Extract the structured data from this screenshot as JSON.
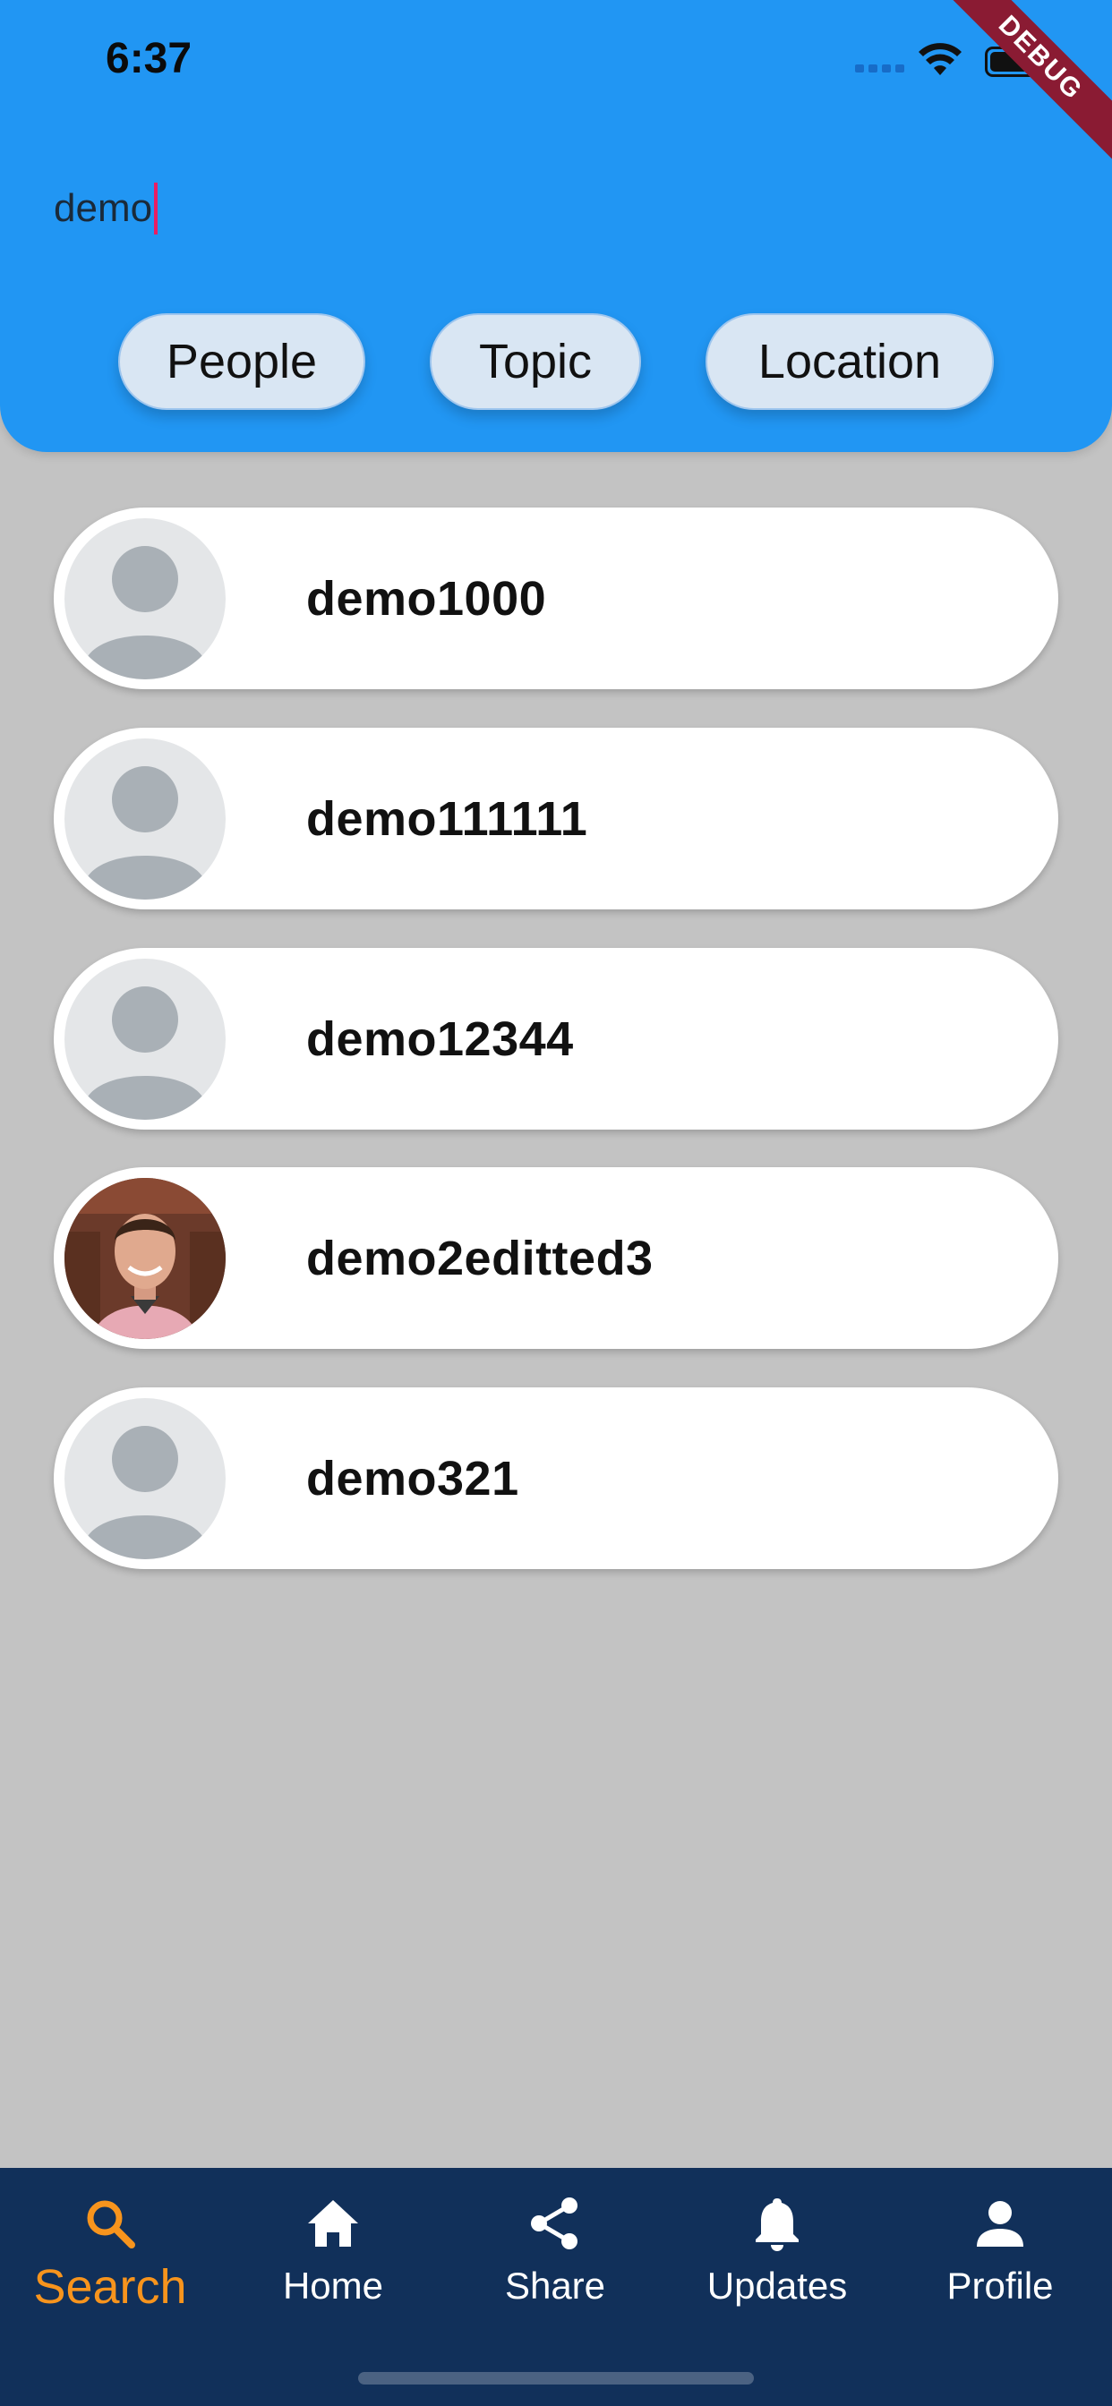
{
  "status_bar": {
    "time": "6:37"
  },
  "debug_banner": "DEBUG",
  "search": {
    "value": "demo"
  },
  "filters": [
    {
      "label": "People"
    },
    {
      "label": "Topic"
    },
    {
      "label": "Location"
    }
  ],
  "results": [
    {
      "name": "demo1000",
      "avatar": "default-avatar-icon"
    },
    {
      "name": "demo111111",
      "avatar": "default-avatar-icon"
    },
    {
      "name": "demo12344",
      "avatar": "default-avatar-icon"
    },
    {
      "name": "demo2editted3",
      "avatar": "user-photo"
    },
    {
      "name": "demo321",
      "avatar": "default-avatar-icon"
    }
  ],
  "bottom_nav": {
    "items": [
      {
        "label": "Search",
        "icon": "search-icon",
        "active": true
      },
      {
        "label": "Home",
        "icon": "home-icon",
        "active": false
      },
      {
        "label": "Share",
        "icon": "share-icon",
        "active": false
      },
      {
        "label": "Updates",
        "icon": "bell-icon",
        "active": false
      },
      {
        "label": "Profile",
        "icon": "person-icon",
        "active": false
      }
    ]
  },
  "colors": {
    "header": "#2196f3",
    "background": "#c3c3c3",
    "nav_background": "#11305a",
    "nav_active": "#f7941d",
    "caret": "#e91e63"
  }
}
